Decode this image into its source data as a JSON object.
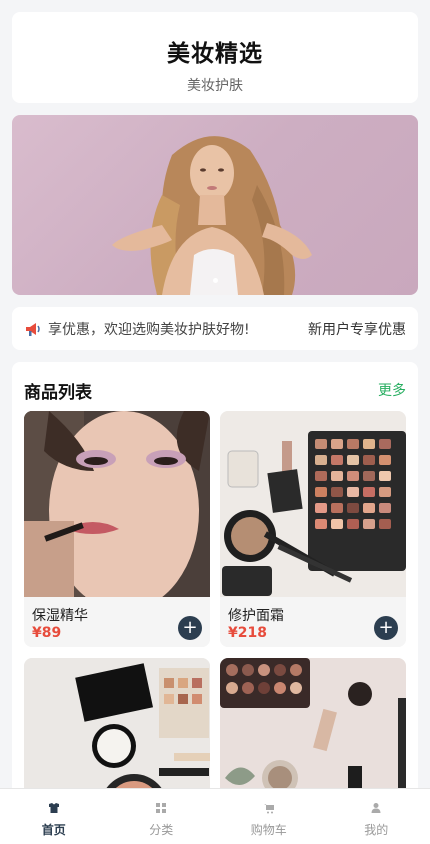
{
  "header": {
    "title": "美妆精选",
    "subtitle": "美妆护肤"
  },
  "notice": {
    "icon": "megaphone-icon",
    "scroll_text": "享优惠，欢迎选购美妆护肤好物!",
    "right_text": "新用户专享优惠"
  },
  "banner": {
    "slide_count": 3,
    "active_index": 1
  },
  "products": {
    "title": "商品列表",
    "more": "更多",
    "items": [
      {
        "name": "保湿精华",
        "price": "¥89",
        "add": "+"
      },
      {
        "name": "修护面霜",
        "price": "¥218",
        "add": "+"
      },
      {
        "name": "",
        "price": "",
        "add": ""
      },
      {
        "name": "",
        "price": "",
        "add": ""
      }
    ]
  },
  "tabbar": {
    "active": "home",
    "tabs": [
      {
        "id": "home",
        "label": "首页",
        "icon": "shirt-icon"
      },
      {
        "id": "category",
        "label": "分类",
        "icon": "grid-icon"
      },
      {
        "id": "cart",
        "label": "购物车",
        "icon": "cart-icon"
      },
      {
        "id": "me",
        "label": "我的",
        "icon": "user-icon"
      }
    ]
  },
  "colors": {
    "accent": "#2c3e50",
    "price": "#e74c3c",
    "more": "#27ae60",
    "background": "#f4f5f7"
  }
}
